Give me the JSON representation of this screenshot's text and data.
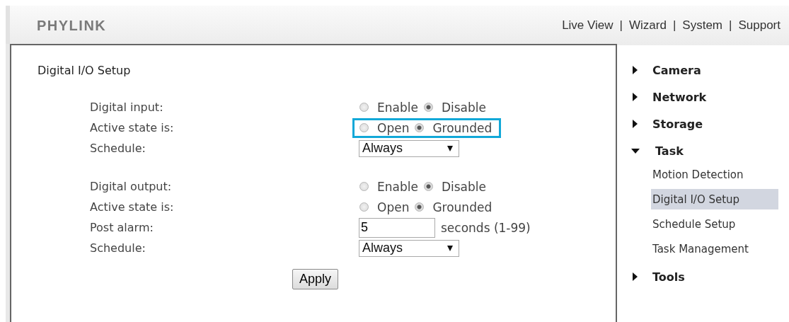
{
  "logo": "PHYLINK",
  "nav": [
    {
      "label": "Live View"
    },
    {
      "separator": "|",
      "label": "Wizard"
    },
    {
      "separator": "|",
      "label": "System"
    },
    {
      "separator": "|",
      "label": "Support"
    }
  ],
  "panel": {
    "title": "Digital I/O Setup",
    "sections": [
      {
        "rows": [
          {
            "kind": "radio",
            "label": "Digital input:",
            "highlighted": false,
            "options": [
              {
                "label": "Enable",
                "selected": false
              },
              {
                "label": "Disable",
                "selected": true
              }
            ]
          },
          {
            "kind": "radio",
            "label": "Active state is:",
            "highlighted": true,
            "options": [
              {
                "label": "Open",
                "selected": false
              },
              {
                "label": "Grounded",
                "selected": true
              }
            ]
          },
          {
            "kind": "select",
            "label": "Schedule:",
            "value": "Always"
          }
        ]
      },
      {
        "rows": [
          {
            "kind": "radio",
            "label": "Digital output:",
            "highlighted": false,
            "options": [
              {
                "label": "Enable",
                "selected": false
              },
              {
                "label": "Disable",
                "selected": true
              }
            ]
          },
          {
            "kind": "radio",
            "label": "Active state is:",
            "highlighted": false,
            "options": [
              {
                "label": "Open",
                "selected": false
              },
              {
                "label": "Grounded",
                "selected": true
              }
            ]
          },
          {
            "kind": "number",
            "label": "Post alarm:",
            "value": "5",
            "unit": "seconds (1-99)"
          },
          {
            "kind": "select",
            "label": "Schedule:",
            "value": "Always"
          }
        ]
      }
    ],
    "button": "Apply"
  },
  "sidebar": {
    "items": [
      {
        "label": "Camera",
        "expanded": false
      },
      {
        "label": "Network",
        "expanded": false
      },
      {
        "label": "Storage",
        "expanded": false
      },
      {
        "label": "Task",
        "expanded": true,
        "children": [
          {
            "label": "Motion Detection",
            "selected": false
          },
          {
            "label": "Digital I/O Setup",
            "selected": true
          },
          {
            "label": "Schedule Setup",
            "selected": false
          },
          {
            "label": "Task Management",
            "selected": false
          }
        ]
      },
      {
        "label": "Tools",
        "expanded": false
      }
    ]
  }
}
